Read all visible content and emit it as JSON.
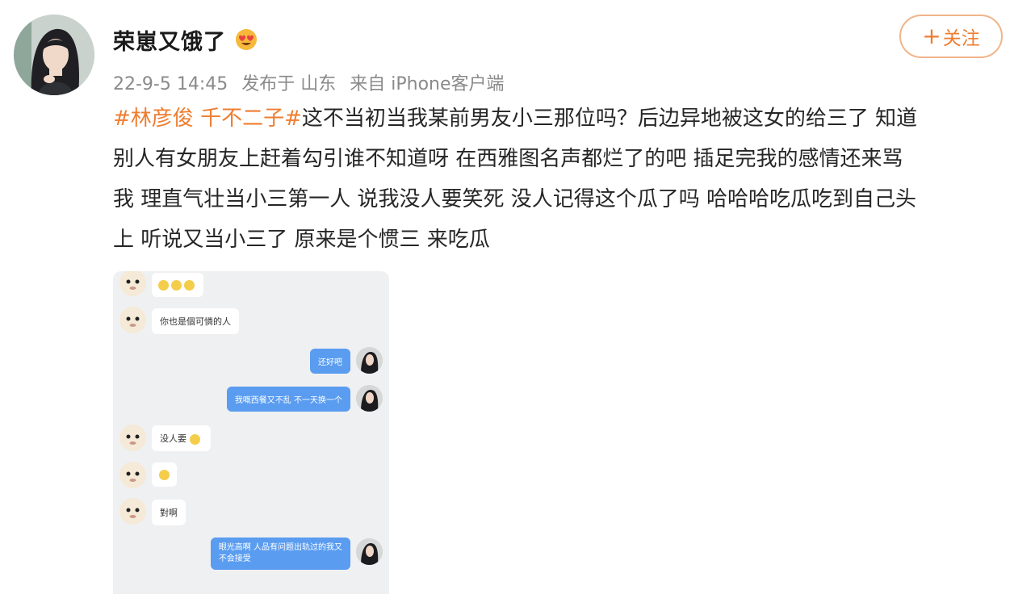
{
  "user": {
    "name": "荣崽又饿了",
    "badge_icon": "heart-eyes-emoji-icon"
  },
  "meta": {
    "date": "22-9-5 14:45",
    "posted_from": "发布于 山东",
    "source": "来自 iPhone客户端"
  },
  "follow_button": {
    "plus": "+",
    "label": "关注"
  },
  "post": {
    "tag1": "#林彦俊",
    "tag2": "千不二子#",
    "line1": "这不当初当我某前男友小三那位吗？后边异地被这女的给三了 知道",
    "line2": "别人有女朋友上赶着勾引谁不知道呀 在西雅图名声都烂了的吧 插足完我的感情还来骂",
    "line3": "我 理直气壮当小三第一人 说我没人要笑死 没人记得这个瓜了吗 哈哈哈吃瓜吃到自己头",
    "line4": "上 听说又当小三了 原来是个惯三 来吃瓜"
  },
  "chat": {
    "messages": [
      {
        "side": "left",
        "text": ""
      },
      {
        "side": "left",
        "text": "你也是個可憐的人"
      },
      {
        "side": "right",
        "text": "还好吧"
      },
      {
        "side": "right",
        "text": "我嘅西餐又不乱 不一天换一个"
      },
      {
        "side": "left",
        "text": "没人要"
      },
      {
        "side": "left",
        "text": ""
      },
      {
        "side": "left",
        "text": "對啊"
      },
      {
        "side": "right",
        "text": "眼光高啊 人品有问题出轨过的我又",
        "text2": "不会接受"
      }
    ]
  },
  "colors": {
    "accent": "#ef7d30",
    "bubble_blue": "#5a9cf0",
    "chat_bg": "#eff0f2"
  }
}
